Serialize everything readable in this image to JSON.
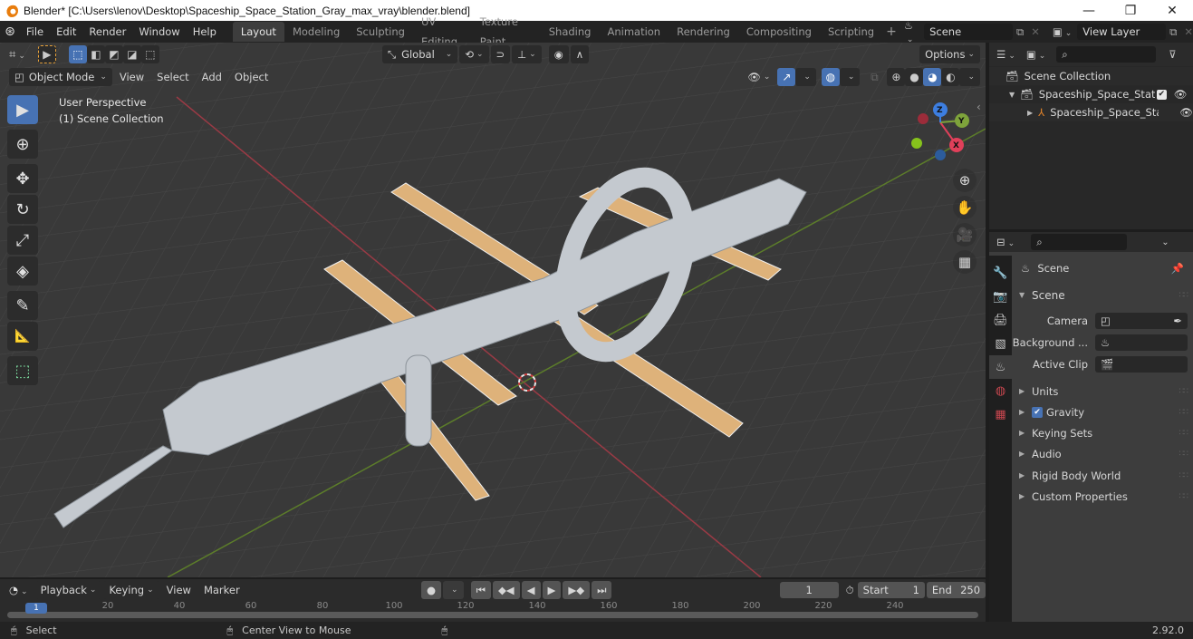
{
  "window": {
    "title": "Blender* [C:\\Users\\lenov\\Desktop\\Spaceship_Space_Station_Gray_max_vray\\blender.blend]",
    "controls": [
      "minimize",
      "restore",
      "close"
    ]
  },
  "menubar": {
    "items": [
      "File",
      "Edit",
      "Render",
      "Window",
      "Help"
    ],
    "workspaces": [
      "Layout",
      "Modeling",
      "Sculpting",
      "UV Editing",
      "Texture Paint",
      "Shading",
      "Animation",
      "Rendering",
      "Compositing",
      "Scripting"
    ],
    "active_workspace": "Layout",
    "add_tab": "+",
    "scene_field": "Scene",
    "view_layer_field": "View Layer"
  },
  "viewport": {
    "mode": "Object Mode",
    "menus": [
      "View",
      "Select",
      "Add",
      "Object"
    ],
    "transform_orientation": "Global",
    "options_label": "Options",
    "overlay_line1": "User Perspective",
    "overlay_line2": "(1) Scene Collection",
    "gizmo_axes": [
      "X",
      "Y",
      "Z"
    ],
    "colors": {
      "x_axis": "#c8424f",
      "y_axis": "#6d9a2a",
      "z_axis": "#3d7ee0",
      "panel_wood": "#e0b47c",
      "model_gray": "#c5cad0",
      "accent": "#4772b3"
    }
  },
  "tools": [
    {
      "name": "select-box",
      "icon": "▶"
    },
    {
      "name": "cursor",
      "icon": "⊕"
    },
    {
      "name": "move",
      "icon": "✥"
    },
    {
      "name": "rotate",
      "icon": "↻"
    },
    {
      "name": "scale",
      "icon": "⤢"
    },
    {
      "name": "transform",
      "icon": "◈"
    },
    {
      "name": "annotate",
      "icon": "✎"
    },
    {
      "name": "measure",
      "icon": "📐"
    },
    {
      "name": "add-cube",
      "icon": "⬚"
    }
  ],
  "outliner": {
    "root": "Scene Collection",
    "items": [
      {
        "label": "Spaceship_Space_Statior",
        "type": "collection",
        "checked": true,
        "visible": true
      },
      {
        "label": "Spaceship_Space_Stа",
        "type": "object",
        "visible": true
      }
    ]
  },
  "properties": {
    "context": "Scene",
    "panel_title": "Scene",
    "fields": [
      {
        "label": "Camera",
        "value": ""
      },
      {
        "label": "Background ...",
        "value": ""
      },
      {
        "label": "Active Clip",
        "value": ""
      }
    ],
    "subpanels": [
      {
        "label": "Units"
      },
      {
        "label": "Gravity",
        "checkbox": true
      },
      {
        "label": "Keying Sets"
      },
      {
        "label": "Audio"
      },
      {
        "label": "Rigid Body World"
      },
      {
        "label": "Custom Properties"
      }
    ]
  },
  "timeline": {
    "menus": [
      "Playback",
      "Keying",
      "View",
      "Marker"
    ],
    "current_frame": "1",
    "start_label": "Start",
    "start": "1",
    "end_label": "End",
    "end": "250",
    "ruler_ticks": [
      "1",
      "20",
      "40",
      "60",
      "80",
      "100",
      "120",
      "140",
      "160",
      "180",
      "200",
      "220",
      "240"
    ]
  },
  "statusbar": {
    "left_action": "Select",
    "middle_action": "Center View to Mouse",
    "version": "2.92.0"
  }
}
